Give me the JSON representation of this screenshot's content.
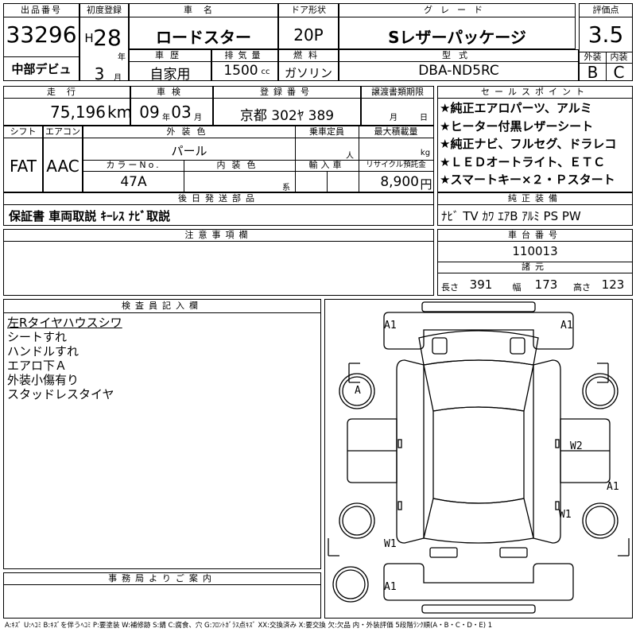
{
  "header": {
    "lot_label": "出品番号",
    "lot_number": "33296",
    "debut": "中部デビュ",
    "first_reg_label": "初度登録",
    "era": "H",
    "year": "28",
    "year_unit": "年",
    "month": "3",
    "month_unit": "月",
    "car_name_label": "車名",
    "car_name": "ロードスター",
    "door_label": "ドア形状",
    "door": "20P",
    "grade_label": "グレード",
    "grade": "Sレザーパッケージ",
    "score_label": "評価点",
    "score": "3.5",
    "history_label": "車歴",
    "history": "自家用",
    "displacement_label": "排気量",
    "displacement": "1500",
    "displacement_unit": "cc",
    "fuel_label": "燃料",
    "fuel": "ガソリン",
    "model_label": "型式",
    "model": "DBA-ND5RC",
    "exterior_label": "外装",
    "exterior": "B",
    "interior_label": "内装",
    "interior": "C"
  },
  "row2": {
    "mileage_label": "走行",
    "mileage": "75,196",
    "mileage_unit": "km",
    "inspection_label": "車検",
    "insp_year": "09",
    "insp_year_unit": "年",
    "insp_month": "03",
    "insp_month_unit": "月",
    "reg_label": "登録番号",
    "reg": "京都 302ﾔ 389",
    "transfer_label": "譲渡書類期限",
    "transfer_month_unit": "月",
    "transfer_day_unit": "日",
    "shift_label": "シフト",
    "shift": "FAT",
    "ac_label": "エアコン",
    "ac": "AAC",
    "ext_color_label": "外装色",
    "ext_color": "パール",
    "capacity_label": "乗車定員",
    "capacity_unit": "人",
    "load_label": "最大積載量",
    "load_unit": "kg",
    "color_no_label": "カラーNo.",
    "color_no": "47A",
    "int_color_label": "内装色",
    "int_color_unit": "系",
    "import_label": "輸入車",
    "recycle_label": "リサイクル預託金",
    "recycle": "8,900",
    "recycle_unit": "円"
  },
  "sales_points": {
    "label": "セールスポイント",
    "items": [
      "★純正エアロパーツ、アルミ",
      "★ヒーター付黒レザーシート",
      "★純正ナビ、フルセグ、ドラレコ",
      "★ＬＥＤオートライト、ＥＴＣ",
      "★スマートキー×２・Ｐスタート"
    ]
  },
  "followup": {
    "label": "後日発送部品",
    "text": "保証書 車両取説 ｷｰﾚｽ ﾅﾋﾞ取説"
  },
  "equipment": {
    "label": "純正装備",
    "text": "ﾅﾋﾞ TV ｶﾜ ｴｱB ｱﾙﾐ PS PW"
  },
  "notes": {
    "label": "注意事項欄"
  },
  "chassis": {
    "label": "車台番号",
    "number": "110013"
  },
  "dims": {
    "label": "諸元",
    "length_label": "長さ",
    "length": "391",
    "width_label": "幅",
    "width": "173",
    "height_label": "高さ",
    "height": "123"
  },
  "inspector": {
    "label": "検査員記入欄",
    "lines": [
      "左Rタイヤハウスシワ",
      "シートすれ",
      "ハンドルすれ",
      "エアロ下Ａ",
      "外装小傷有り",
      "スタッドレスタイヤ"
    ]
  },
  "office": {
    "label": "事務局よりご案内"
  },
  "diagram": {
    "marks": [
      "A1",
      "A1",
      "A",
      "W2",
      "A1",
      "W1",
      "W1",
      "A1"
    ]
  },
  "legend": "A:ｷｽﾞ U:ﾍｺﾐ B:ｷｽﾞを伴うﾍｺﾐ P:要塗装 W:補修跡 S:錆 C:腐食、穴 G:ﾌﾛﾝﾄｶﾞﾗｽ点ｷｽﾞ XX:交換済み X:要交換 欠:欠品 内・外装評価 5段階ﾗﾝｸ順(A・B・C・D・E) 1"
}
